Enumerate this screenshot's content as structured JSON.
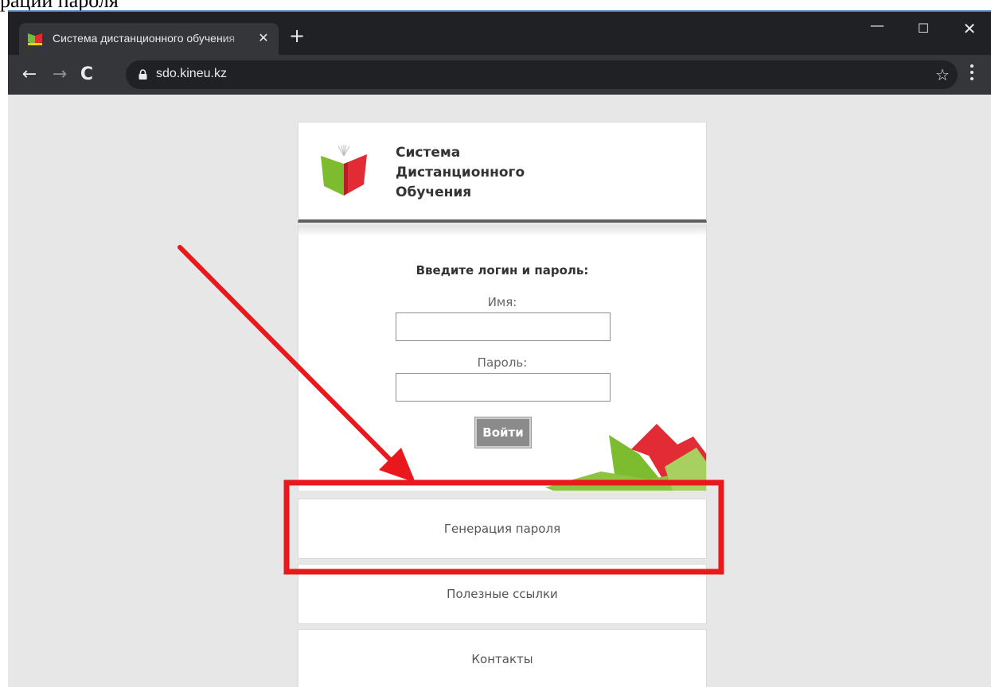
{
  "document_fragment": "рации пароля",
  "browser": {
    "tab_title": "Система дистанционного обучения",
    "tab_close": "✕",
    "new_tab": "+",
    "url": "sdo.kineu.kz",
    "window_minimize": "—",
    "window_maximize": "☐",
    "window_close": "✕",
    "back": "←",
    "forward": "→",
    "reload": "C",
    "bookmark": "☆"
  },
  "site": {
    "title_lines": [
      "Система",
      "Дистанционного",
      "Обучения"
    ]
  },
  "login": {
    "heading": "Введите логин и пароль:",
    "name_label": "Имя:",
    "name_value": "",
    "password_label": "Пароль:",
    "password_value": "",
    "submit_label": "Войти"
  },
  "menu": {
    "items": [
      {
        "label": "Генерация пароля"
      },
      {
        "label": "Полезные ссылки"
      },
      {
        "label": "Контакты"
      }
    ]
  },
  "colors": {
    "highlight": "#e8181c",
    "chrome_dark": "#202124",
    "chrome_toolbar": "#35363a",
    "page_bg": "#e7e7e7"
  },
  "icons": [
    "favicon-icon",
    "close-icon",
    "plus-icon",
    "back-arrow-icon",
    "forward-arrow-icon",
    "reload-icon",
    "lock-icon",
    "star-icon",
    "kebab-menu-icon",
    "book-logo-icon"
  ]
}
